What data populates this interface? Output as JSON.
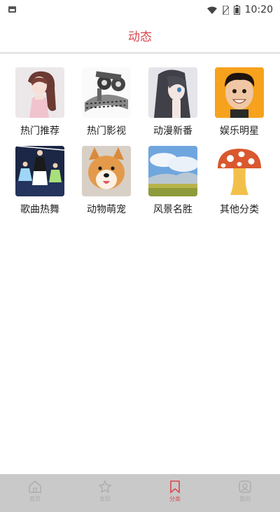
{
  "status_bar": {
    "time": "10:20"
  },
  "header": {
    "title": "动态"
  },
  "categories": [
    {
      "label": "热门推荐"
    },
    {
      "label": "热门影视"
    },
    {
      "label": "动漫新番"
    },
    {
      "label": "娱乐明星"
    },
    {
      "label": "歌曲热舞"
    },
    {
      "label": "动物萌宠"
    },
    {
      "label": "风景名胜"
    },
    {
      "label": "其他分类"
    }
  ],
  "tabbar": {
    "tabs": [
      {
        "label": "首页",
        "icon": "home-icon"
      },
      {
        "label": "发现",
        "icon": "star-icon"
      },
      {
        "label": "分类",
        "icon": "bookmark-icon",
        "active": true
      },
      {
        "label": "我的",
        "icon": "profile-icon"
      }
    ]
  },
  "colors": {
    "accent": "#d9484f",
    "tabbar_bg": "#c9c9c9"
  }
}
